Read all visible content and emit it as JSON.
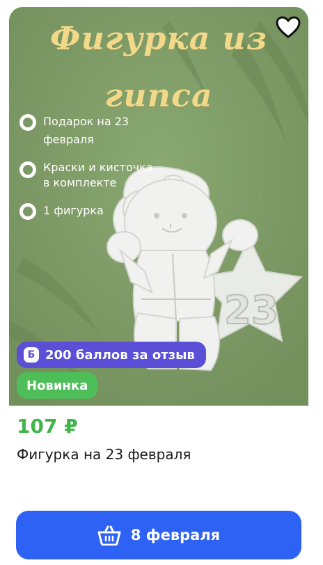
{
  "product": {
    "title_line1": "Фигурка из",
    "title_line2": "гипса",
    "features": [
      {
        "text1": "Подарок на 23",
        "text2": "февраля"
      },
      {
        "text1": "Краски и кисточка",
        "text2": "в комплекте"
      },
      {
        "text1": "1 фигурка",
        "text2": ""
      }
    ],
    "figure_number": "23",
    "points_icon_letter": "Б",
    "points_label": "200 баллов за отзыв",
    "new_badge": "Новинка",
    "price": "107 ₽",
    "name": "Фигурка на 23 февраля",
    "cart_button_label": "8 февраля"
  },
  "colors": {
    "image_background": "#7f9c66",
    "title_color": "#f2d98a",
    "points_badge": "#5a4fd6",
    "new_badge": "#4ebf58",
    "price": "#41b44a",
    "cart_button": "#2e62f5"
  },
  "icons": {
    "favorite": "heart-outline-icon",
    "cart": "basket-icon"
  }
}
